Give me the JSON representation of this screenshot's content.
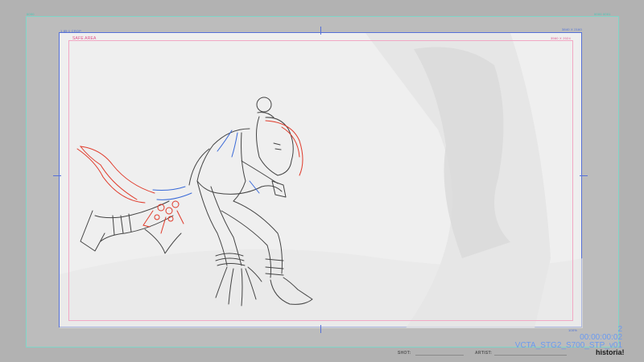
{
  "frame": {
    "corner_top_left": "0000",
    "corner_top_right": "0000 0001",
    "guide_label": "1.85:1 CROP",
    "canvas_size_label": "3840 X 2160",
    "safe_area_label": "SAFE AREA",
    "safe_size_label": "3560 X 2024",
    "zoom_label": "100%"
  },
  "slate": {
    "shot_number": "2",
    "timecode": "00:00:00:02",
    "file_name": "VCTA_STG2_S700_STP_v01"
  },
  "footer": {
    "shot_label": "SHOT:",
    "artist_label": "ARTIST:",
    "logo_text": "historia!"
  },
  "colors": {
    "guide_blue": "#5570d8",
    "frame_cyan": "#7fd6c8",
    "safe_pink": "#f2a8c4",
    "sketch_red": "#e03a2a",
    "sketch_blue": "#3a6ad8"
  }
}
